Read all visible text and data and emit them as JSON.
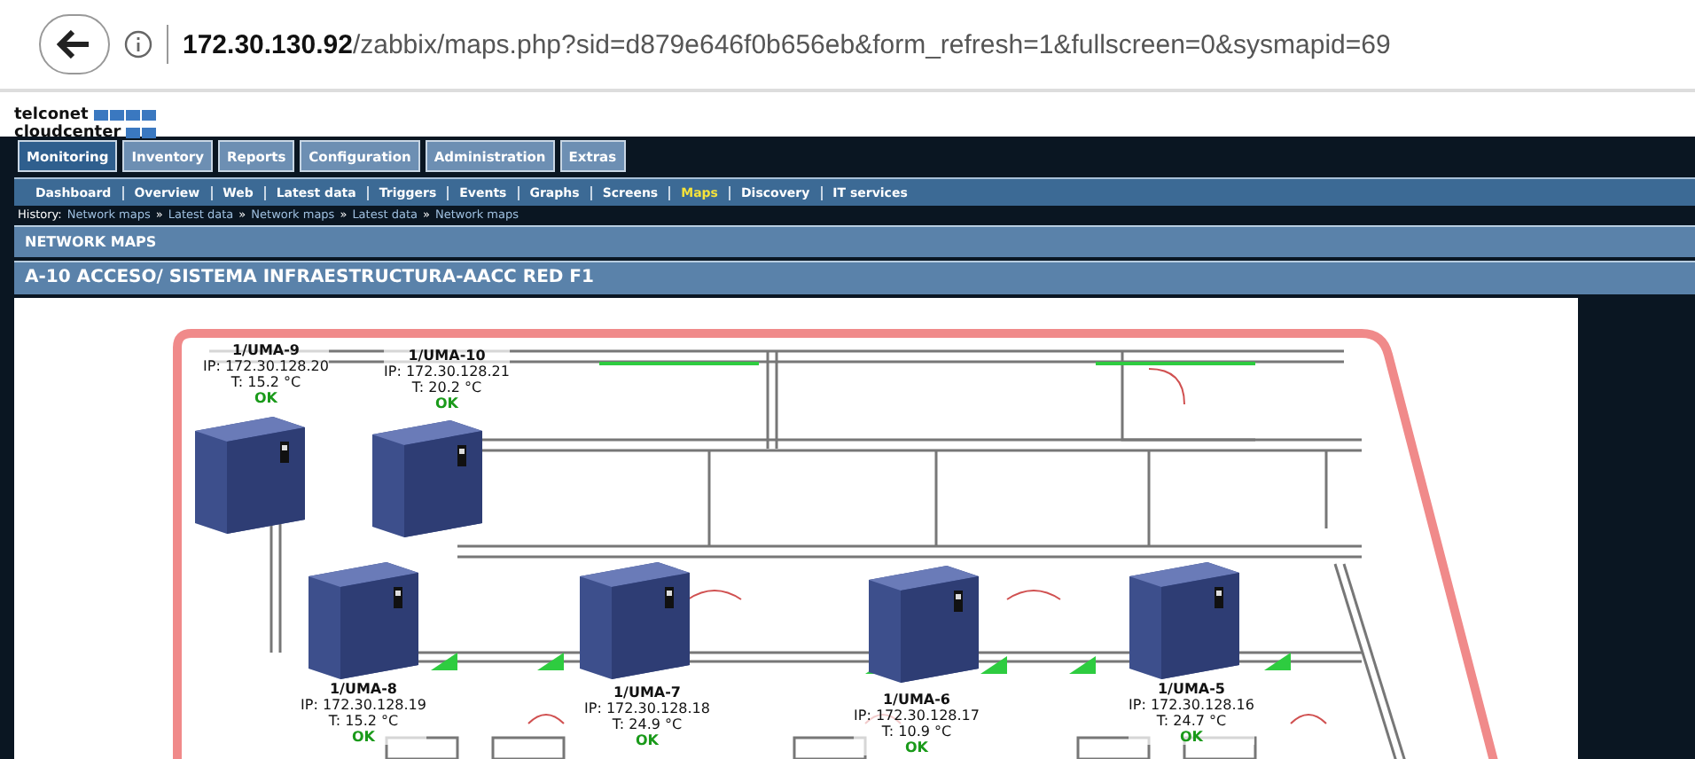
{
  "browser": {
    "url": "**172.30.130.92**/zabbix/maps.php?sid=d879e646f0b656eb&form_refresh=1&fullscreen=0&sysmapid=69"
  },
  "logo": {
    "line_1": "telconet",
    "line_2": "cloudcenter"
  },
  "main_menu": [
    {
      "label": "Monitoring",
      "selected": true
    },
    {
      "label": "Inventory",
      "selected": false
    },
    {
      "label": "Reports",
      "selected": false
    },
    {
      "label": "Configuration",
      "selected": false
    },
    {
      "label": "Administration",
      "selected": false
    },
    {
      "label": "Extras",
      "selected": false
    }
  ],
  "sub_menu": [
    {
      "label": "Dashboard",
      "selected": false
    },
    {
      "label": "Overview",
      "selected": false
    },
    {
      "label": "Web",
      "selected": false
    },
    {
      "label": "Latest data",
      "selected": false
    },
    {
      "label": "Triggers",
      "selected": false
    },
    {
      "label": "Events",
      "selected": false
    },
    {
      "label": "Graphs",
      "selected": false
    },
    {
      "label": "Screens",
      "selected": false
    },
    {
      "label": "Maps",
      "selected": true
    },
    {
      "label": "Discovery",
      "selected": false
    },
    {
      "label": "IT services",
      "selected": false
    }
  ],
  "history": {
    "label": "History:",
    "separator": "»",
    "links": [
      "Network maps",
      "Latest data",
      "Network maps",
      "Latest data",
      "Network maps"
    ]
  },
  "section_header": "NETWORK MAPS",
  "map": {
    "title": "A-10 ACCESO/ SISTEMA INFRAESTRUCTURA-AACC RED F1",
    "nodes": [
      {
        "name": "1/UMA-9",
        "ip": "IP: 172.30.128.20",
        "temperature": "T: 15.2 °C",
        "status": "OK"
      },
      {
        "name": "1/UMA-10",
        "ip": "IP: 172.30.128.21",
        "temperature": "T: 20.2 °C",
        "status": "OK"
      },
      {
        "name": "1/UMA-8",
        "ip": "IP: 172.30.128.19",
        "temperature": "T: 15.2 °C",
        "status": "OK"
      },
      {
        "name": "1/UMA-7",
        "ip": "IP: 172.30.128.18",
        "temperature": "T: 24.9 °C",
        "status": "OK"
      },
      {
        "name": "1/UMA-6",
        "ip": "IP: 172.30.128.17",
        "temperature": "T: 10.9 °C",
        "status": "OK"
      },
      {
        "name": "1/UMA-5",
        "ip": "IP: 172.30.128.16",
        "temperature": "T: 24.7 °C",
        "status": "OK"
      }
    ]
  }
}
